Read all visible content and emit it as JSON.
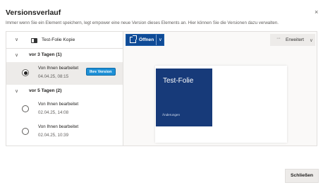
{
  "dialog": {
    "title": "Versionsverlauf",
    "subtitle": "Immer wenn Sie ein Element speichern, legt empower eine neue Version dieses Elements an. Hier können Sie die Versionen dazu verwalten.",
    "close_glyph": "×"
  },
  "file": {
    "name": "Test-Folie Kopie",
    "chevron_glyph": "∨"
  },
  "groups": [
    {
      "label": "vor 3 Tagen (1)",
      "chevron_glyph": "∨",
      "versions": [
        {
          "author": "Von Ihnen bearbeitet",
          "date": "04.04.25, 08:15",
          "selected": true,
          "badge": "Ihre Version"
        }
      ]
    },
    {
      "label": "vor 5 Tagen (2)",
      "chevron_glyph": "∨",
      "versions": [
        {
          "author": "Von Ihnen bearbeitet",
          "date": "02.04.25, 14:08",
          "selected": false
        },
        {
          "author": "Von Ihnen bearbeitet",
          "date": "02.04.25, 10:39",
          "selected": false
        }
      ]
    }
  ],
  "toolbar": {
    "open_label": "Öffnen",
    "open_chevron": "∨",
    "advanced_dots": "···",
    "advanced_label": "Erweitert",
    "advanced_chevron": "∨"
  },
  "preview": {
    "slide_title": "Test-Folie",
    "slide_subtitle": "Änderungen"
  },
  "footer": {
    "close_label": "Schließen"
  },
  "colors": {
    "primary": "#0f4b96",
    "badge": "#1e90d6",
    "slide_background": "#173a79",
    "selected_row": "#edebe9"
  },
  "icons": {
    "file": "slide-file-icon",
    "open": "open-external-icon",
    "more": "more-dots-icon"
  }
}
